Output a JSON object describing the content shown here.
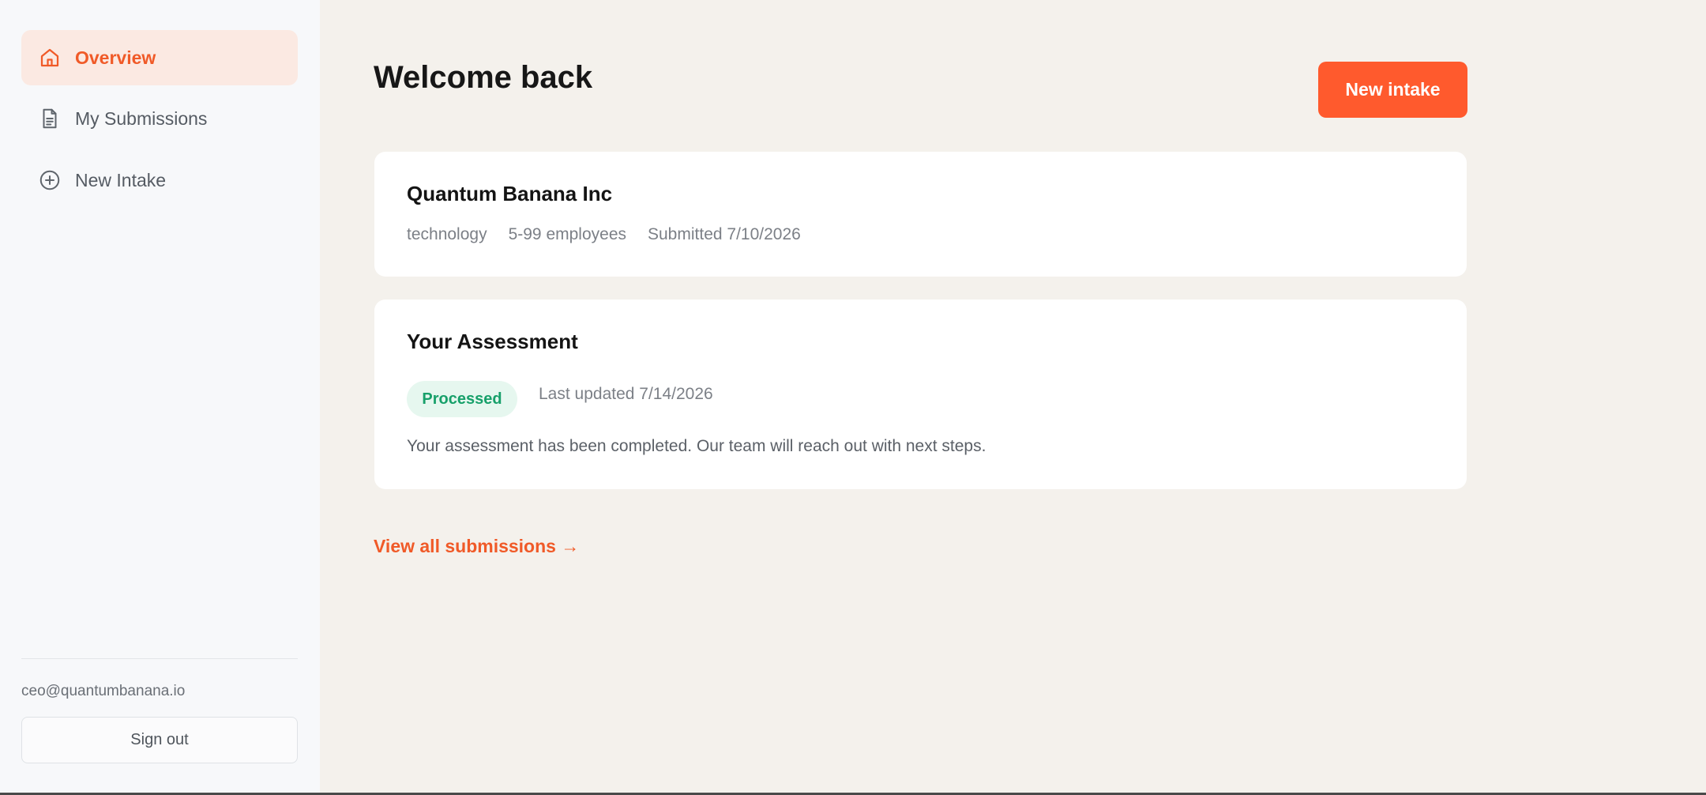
{
  "sidebar": {
    "items": [
      {
        "label": "Overview",
        "icon": "home-icon",
        "active": true
      },
      {
        "label": "My Submissions",
        "icon": "document-icon",
        "active": false
      },
      {
        "label": "New Intake",
        "icon": "plus-circle-icon",
        "active": false
      }
    ],
    "user_email": "ceo@quantumbanana.io",
    "sign_out_label": "Sign out"
  },
  "main": {
    "title": "Welcome back",
    "new_intake_label": "New intake",
    "company": {
      "name": "Quantum Banana Inc",
      "industry": "technology",
      "size": "5-99 employees",
      "submitted": "Submitted 7/10/2026"
    },
    "assessment": {
      "title": "Your Assessment",
      "status": "Processed",
      "updated": "Last updated 7/14/2026",
      "message": "Your assessment has been completed. Our team will reach out with next steps."
    },
    "view_all_label": "View all submissions →"
  },
  "colors": {
    "accent": "#ff5a2d",
    "accent_text": "#f05a28",
    "success": "#17a06a",
    "background": "#f4f1ec"
  }
}
